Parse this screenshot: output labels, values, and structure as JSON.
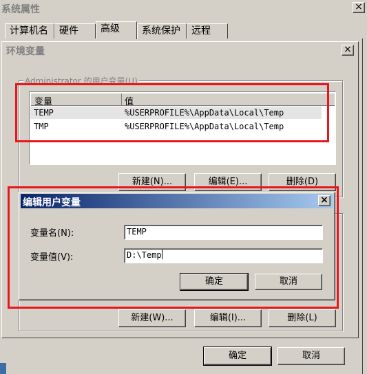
{
  "sysprops": {
    "title": "系统属性",
    "tabs": [
      "计算机名",
      "硬件",
      "高级",
      "系统保护",
      "远程"
    ],
    "ok_label": "确定",
    "cancel_label": "取消"
  },
  "envvars": {
    "title": "环境变量",
    "user_group_label": "Administrator 的用户变量(U)",
    "col_name": "变量",
    "col_value": "值",
    "rows": [
      {
        "name": "TEMP",
        "value": "%USERPROFILE%\\AppData\\Local\\Temp"
      },
      {
        "name": "TMP",
        "value": "%USERPROFILE%\\AppData\\Local\\Temp"
      }
    ],
    "user_new_label": "新建(N)...",
    "user_edit_label": "编辑(E)...",
    "user_delete_label": "删除(D)",
    "sys_new_label": "新建(W)...",
    "sys_edit_label": "编辑(I)...",
    "sys_delete_label": "删除(L)"
  },
  "edit_dialog": {
    "title": "编辑用户变量",
    "name_label": "变量名(N):",
    "name_value": "TEMP",
    "value_label": "变量值(V):",
    "value_value": "D:\\Temp",
    "ok_label": "确定",
    "cancel_label": "取消"
  },
  "colors": {
    "active_title": "#0a246a",
    "highlight": "#e8161b"
  }
}
